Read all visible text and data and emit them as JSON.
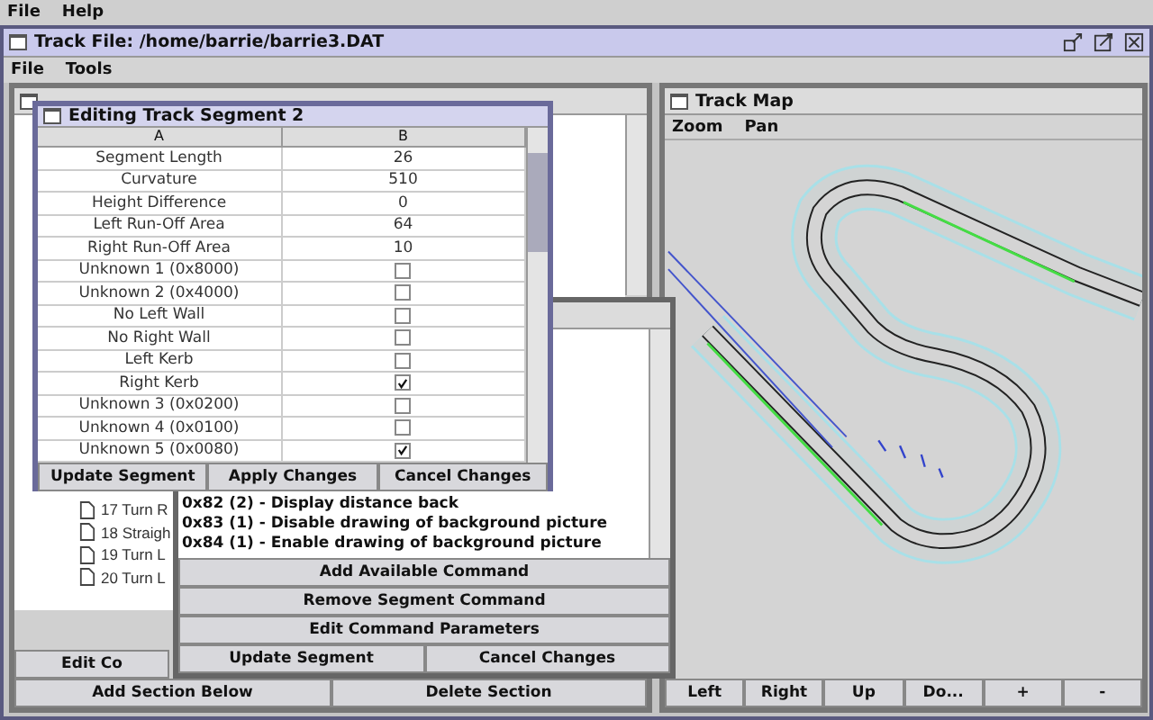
{
  "menu_bar": [
    "File",
    "Help"
  ],
  "main_window": {
    "title": "Track File: /home/barrie/barrie3.DAT",
    "menu": [
      "File",
      "Tools"
    ]
  },
  "object_view": {
    "tree_items": [
      "17 Turn R",
      "18 Straigh",
      "19 Turn L",
      "20 Turn L"
    ],
    "edit_button": "Edit Co",
    "buttons": [
      "Add Section Below",
      "Delete Section"
    ]
  },
  "segment_editor": {
    "title": "Editing Track Segment 2",
    "columns": [
      "A",
      "B"
    ],
    "rows": [
      {
        "label": "Segment Length",
        "kind": "value",
        "value": "26"
      },
      {
        "label": "Curvature",
        "kind": "value",
        "value": "510"
      },
      {
        "label": "Height Difference",
        "kind": "value",
        "value": "0"
      },
      {
        "label": "Left Run-Off Area",
        "kind": "value",
        "value": "64"
      },
      {
        "label": "Right Run-Off Area",
        "kind": "value",
        "value": "10"
      },
      {
        "label": "Unknown 1 (0x8000)",
        "kind": "checkbox",
        "checked": false
      },
      {
        "label": "Unknown 2 (0x4000)",
        "kind": "checkbox",
        "checked": false
      },
      {
        "label": "No Left Wall",
        "kind": "checkbox",
        "checked": false
      },
      {
        "label": "No Right Wall",
        "kind": "checkbox",
        "checked": false
      },
      {
        "label": "Left Kerb",
        "kind": "checkbox",
        "checked": false
      },
      {
        "label": "Right Kerb",
        "kind": "checkbox",
        "checked": true
      },
      {
        "label": "Unknown 3 (0x0200)",
        "kind": "checkbox",
        "checked": false
      },
      {
        "label": "Unknown 4 (0x0100)",
        "kind": "checkbox",
        "checked": false
      },
      {
        "label": "Unknown 5 (0x0080)",
        "kind": "checkbox",
        "checked": true
      }
    ],
    "buttons": [
      "Update Segment",
      "Apply Changes",
      "Cancel Changes"
    ]
  },
  "command_editor": {
    "commands": [
      "0x82 (2) - Display distance back",
      "0x83 (1) - Disable drawing of background picture",
      "0x84 (1) - Enable drawing of background picture"
    ],
    "buttons": [
      "Add Available Command",
      "Remove Segment Command",
      "Edit Command Parameters"
    ],
    "footer_buttons": [
      "Update Segment",
      "Cancel Changes"
    ]
  },
  "track_map": {
    "title": "Track Map",
    "menu": [
      "Zoom",
      "Pan"
    ],
    "buttons": [
      "Left",
      "Right",
      "Up",
      "Do...",
      "+",
      "-"
    ]
  }
}
